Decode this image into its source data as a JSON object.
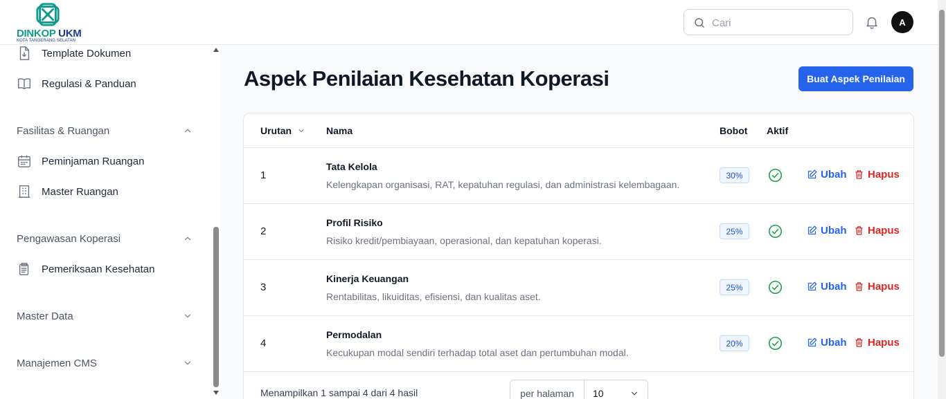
{
  "brand": {
    "name": "DINKOP",
    "name_accent": "UKM",
    "subtitle": "KOTA TANGERANG SELATAN"
  },
  "header": {
    "search_placeholder": "Cari",
    "avatar_initial": "A"
  },
  "sidebar": {
    "items_top": [
      {
        "label": "Template Dokumen",
        "icon": "document-download-icon"
      },
      {
        "label": "Regulasi & Panduan",
        "icon": "book-open-icon"
      }
    ],
    "sections": [
      {
        "label": "Fasilitas & Ruangan",
        "expanded": true,
        "items": [
          {
            "label": "Peminjaman Ruangan",
            "icon": "calendar-icon"
          },
          {
            "label": "Master Ruangan",
            "icon": "building-icon"
          }
        ]
      },
      {
        "label": "Pengawasan Koperasi",
        "expanded": true,
        "items": [
          {
            "label": "Pemeriksaan Kesehatan",
            "icon": "clipboard-icon"
          }
        ]
      },
      {
        "label": "Master Data",
        "expanded": false,
        "items": []
      },
      {
        "label": "Manajemen CMS",
        "expanded": false,
        "items": []
      }
    ]
  },
  "main": {
    "title": "Aspek Penilaian Kesehatan Koperasi",
    "create_button": "Buat Aspek Penilaian",
    "table": {
      "headers": {
        "urutan": "Urutan",
        "nama": "Nama",
        "bobot": "Bobot",
        "aktif": "Aktif"
      },
      "rows": [
        {
          "urutan": "1",
          "nama": "Tata Kelola",
          "deskripsi": "Kelengkapan organisasi, RAT, kepatuhan regulasi, dan administrasi kelembagaan.",
          "bobot": "30%",
          "aktif": true,
          "edit": "Ubah",
          "delete": "Hapus"
        },
        {
          "urutan": "2",
          "nama": "Profil Risiko",
          "deskripsi": "Risiko kredit/pembiayaan, operasional, dan kepatuhan koperasi.",
          "bobot": "25%",
          "aktif": true,
          "edit": "Ubah",
          "delete": "Hapus"
        },
        {
          "urutan": "3",
          "nama": "Kinerja Keuangan",
          "deskripsi": "Rentabilitas, likuiditas, efisiensi, dan kualitas aset.",
          "bobot": "25%",
          "aktif": true,
          "edit": "Ubah",
          "delete": "Hapus"
        },
        {
          "urutan": "4",
          "nama": "Permodalan",
          "deskripsi": "Kecukupan modal sendiri terhadap total aset dan pertumbuhan modal.",
          "bobot": "20%",
          "aktif": true,
          "edit": "Ubah",
          "delete": "Hapus"
        }
      ],
      "footer": {
        "summary": "Menampilkan 1 sampai 4 dari 4 hasil",
        "per_page_label": "per halaman",
        "per_page_value": "10"
      }
    }
  },
  "colors": {
    "primary": "#2563eb",
    "danger": "#dc2626",
    "success": "#16a34a",
    "brand_teal": "#0f9d8a",
    "brand_navy": "#1e3a8a"
  }
}
